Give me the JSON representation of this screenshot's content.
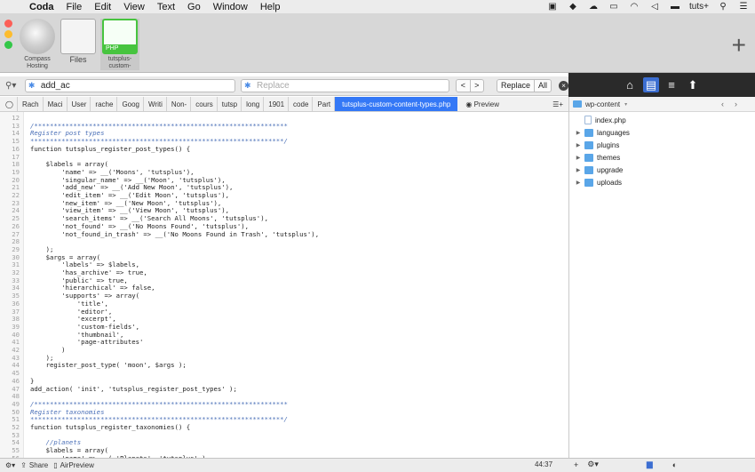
{
  "menubar": {
    "apple": "",
    "app_name": "Coda",
    "items": [
      "File",
      "Edit",
      "View",
      "Text",
      "Go",
      "Window",
      "Help"
    ],
    "user": "tuts+",
    "status_icons": [
      "screen-icon",
      "dropbox-icon",
      "airplay-icon",
      "wifi-icon",
      "volume-icon",
      "battery-icon",
      "user-label",
      "spotlight-icon",
      "notifications-icon"
    ]
  },
  "sites": [
    {
      "label": "Compass Hosting",
      "icon": "compass-icon"
    },
    {
      "label": "Files",
      "icon": "files-icon"
    },
    {
      "label": "tutsplus-custom-",
      "tag": "PHP",
      "icon": "php-icon",
      "selected": true
    }
  ],
  "find": {
    "query": "add_ac",
    "replace_placeholder": "Replace",
    "replace_label": "Replace",
    "all_label": "All",
    "prev": "<",
    "next": ">"
  },
  "breadcrumbs": [
    "Rach",
    "Maci",
    "User",
    "rache",
    "Goog",
    "Writi",
    "Non-",
    "cours",
    "tutsp",
    "long",
    "1901",
    "code",
    "Part"
  ],
  "active_file": "tutsplus-custom-content-types.php",
  "preview_label": "Preview",
  "editor": {
    "lines": [
      {
        "n": "12",
        "text": ""
      },
      {
        "n": "13",
        "text": "/*****************************************************************",
        "cls": "c-com"
      },
      {
        "n": "14",
        "text": "Register post types",
        "cls": "c-com"
      },
      {
        "n": "15",
        "text": "*****************************************************************/",
        "cls": "c-com"
      },
      {
        "n": "16",
        "text": "function tutsplus_register_post_types() {"
      },
      {
        "n": "17",
        "text": ""
      },
      {
        "n": "18",
        "text": "    $labels = array("
      },
      {
        "n": "19",
        "text": "        'name' => __('Moons', 'tutsplus'),"
      },
      {
        "n": "20",
        "text": "        'singular_name' => __('Moon', 'tutsplus'),"
      },
      {
        "n": "21",
        "text": "        'add_new' => __('Add New Moon', 'tutsplus'),"
      },
      {
        "n": "22",
        "text": "        'edit_item' => __('Edit Moon', 'tutsplus'),"
      },
      {
        "n": "23",
        "text": "        'new_item' => __('New Moon', 'tutsplus'),"
      },
      {
        "n": "24",
        "text": "        'view_item' => __('View Moon', 'tutsplus'),"
      },
      {
        "n": "25",
        "text": "        'search_items' => __('Search All Moons', 'tutsplus'),"
      },
      {
        "n": "26",
        "text": "        'not_found' => __('No Moons Found', 'tutsplus'),"
      },
      {
        "n": "27",
        "text": "        'not_found_in_trash' => __('No Moons Found in Trash', 'tutsplus'),"
      },
      {
        "n": "28",
        "text": ""
      },
      {
        "n": "29",
        "text": "    );"
      },
      {
        "n": "30",
        "text": "    $args = array("
      },
      {
        "n": "31",
        "text": "        'labels' => $labels,"
      },
      {
        "n": "32",
        "text": "        'has_archive' => true,"
      },
      {
        "n": "33",
        "text": "        'public' => true,"
      },
      {
        "n": "34",
        "text": "        'hierarchical' => false,"
      },
      {
        "n": "35",
        "text": "        'supports' => array("
      },
      {
        "n": "36",
        "text": "            'title',"
      },
      {
        "n": "37",
        "text": "            'editor',"
      },
      {
        "n": "38",
        "text": "            'excerpt',"
      },
      {
        "n": "39",
        "text": "            'custom-fields',"
      },
      {
        "n": "40",
        "text": "            'thumbnail',"
      },
      {
        "n": "41",
        "text": "            'page-attributes'"
      },
      {
        "n": "42",
        "text": "        )"
      },
      {
        "n": "43",
        "text": "    );"
      },
      {
        "n": "44",
        "text": "    register_post_type( 'moon', $args );"
      },
      {
        "n": "45",
        "text": ""
      },
      {
        "n": "46",
        "text": "}"
      },
      {
        "n": "47",
        "text": "add_action( 'init', 'tutsplus_register_post_types' );"
      },
      {
        "n": "48",
        "text": ""
      },
      {
        "n": "49",
        "text": "/*****************************************************************",
        "cls": "c-com"
      },
      {
        "n": "50",
        "text": "Register taxonomies",
        "cls": "c-com"
      },
      {
        "n": "51",
        "text": "*****************************************************************/",
        "cls": "c-com"
      },
      {
        "n": "52",
        "text": "function tutsplus_register_taxonomies() {"
      },
      {
        "n": "53",
        "text": ""
      },
      {
        "n": "54",
        "text": "    //planets",
        "cls": "c-com"
      },
      {
        "n": "55",
        "text": "    $labels = array("
      },
      {
        "n": "56",
        "text": "        'name' => __( 'Planets', 'tutsplus' ),"
      }
    ]
  },
  "file_panel": {
    "path": "wp-content",
    "items": [
      {
        "name": "index.php",
        "type": "file"
      },
      {
        "name": "languages",
        "type": "folder"
      },
      {
        "name": "plugins",
        "type": "folder"
      },
      {
        "name": "themes",
        "type": "folder"
      },
      {
        "name": "upgrade",
        "type": "folder"
      },
      {
        "name": "uploads",
        "type": "folder"
      }
    ]
  },
  "statusbar": {
    "share": "Share",
    "airpreview": "AirPreview",
    "position": "44:37"
  }
}
